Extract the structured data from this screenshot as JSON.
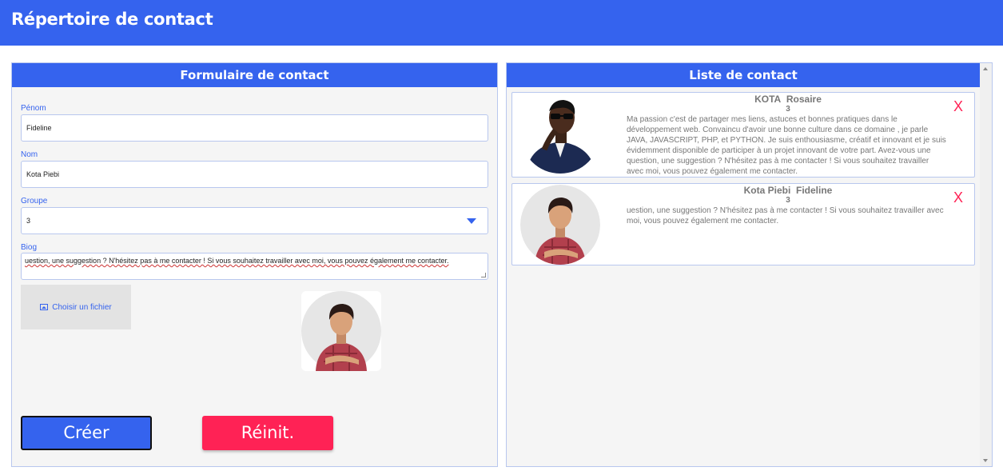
{
  "header": {
    "title": "Répertoire de contact"
  },
  "form": {
    "title": "Formulaire de contact",
    "prenom_label": "Pénom",
    "prenom_value": "Fideline",
    "nom_label": "Nom",
    "nom_value": "Kota Piebi",
    "groupe_label": "Groupe",
    "groupe_value": "3",
    "bio_label": "Biog",
    "bio_value": "uestion, une suggestion ? N'hésitez pas à me contacter ! Si vous souhaitez travailler avec moi, vous pouvez également me contacter.",
    "file_button_label": "Choisir un fichier",
    "create_label": "Créer",
    "reset_label": "Réinit."
  },
  "list": {
    "title": "Liste de contact",
    "contacts": [
      {
        "nom": "KOTA",
        "prenom": "Rosaire",
        "groupe": "3",
        "bio": "Ma passion c'est de partager mes liens, astuces et bonnes pratiques dans le développement web. Convaincu d'avoir une bonne culture dans ce domaine , je parle JAVA, JAVASCRIPT, PHP, et PYTHON. Je suis enthousiasme, créatif et innovant et je suis évidemment disponible de participer à un projet innovant de votre part. Avez-vous une question, une suggestion ? N'hésitez pas à me contacter ! Si vous souhaitez travailler avec moi, vous pouvez également me contacter.",
        "delete_label": "X"
      },
      {
        "nom": "Kota Piebi",
        "prenom": "Fideline",
        "groupe": "3",
        "bio": "uestion, une suggestion ? N'hésitez pas à me contacter ! Si vous souhaitez travailler avec moi, vous pouvez également me contacter.",
        "delete_label": "X"
      }
    ]
  },
  "colors": {
    "primary": "#3563ee",
    "danger": "#ff2255",
    "panel_bg": "#f5f5f5",
    "border": "#b8c7ee"
  },
  "icons": {
    "file": "image-icon",
    "select": "chevron-down-icon",
    "delete": "close-icon"
  }
}
